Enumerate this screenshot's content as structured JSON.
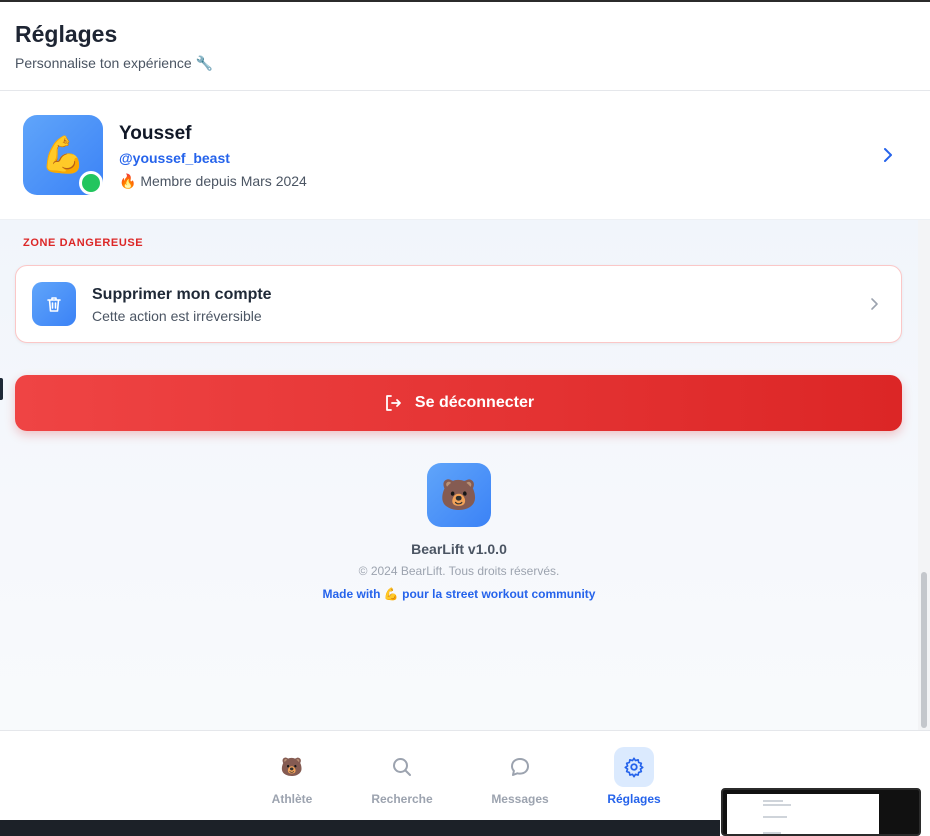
{
  "header": {
    "title": "Réglages",
    "subtitle": "Personnalise ton expérience 🔧"
  },
  "profile": {
    "avatar_emoji": "💪",
    "name": "Youssef",
    "handle": "@youssef_beast",
    "member_since": "🔥 Membre depuis Mars 2024",
    "status": "online"
  },
  "danger_zone": {
    "label": "ZONE DANGEREUSE",
    "delete_account": {
      "title": "Supprimer mon compte",
      "subtitle": "Cette action est irréversible"
    }
  },
  "logout": {
    "label": "Se déconnecter"
  },
  "footer": {
    "logo_emoji": "🐻",
    "version": "BearLift v1.0.0",
    "copyright": "© 2024 BearLift. Tous droits réservés.",
    "made_with": "Made with 💪 pour la street workout community"
  },
  "bottom_nav": {
    "items": [
      {
        "label": "Athlète",
        "icon": "bear-icon",
        "active": false
      },
      {
        "label": "Recherche",
        "icon": "search-icon",
        "active": false
      },
      {
        "label": "Messages",
        "icon": "message-icon",
        "active": false
      },
      {
        "label": "Réglages",
        "icon": "gear-icon",
        "active": true
      }
    ]
  },
  "colors": {
    "accent": "#2563eb",
    "danger": "#dc2626",
    "online": "#22c55e"
  }
}
